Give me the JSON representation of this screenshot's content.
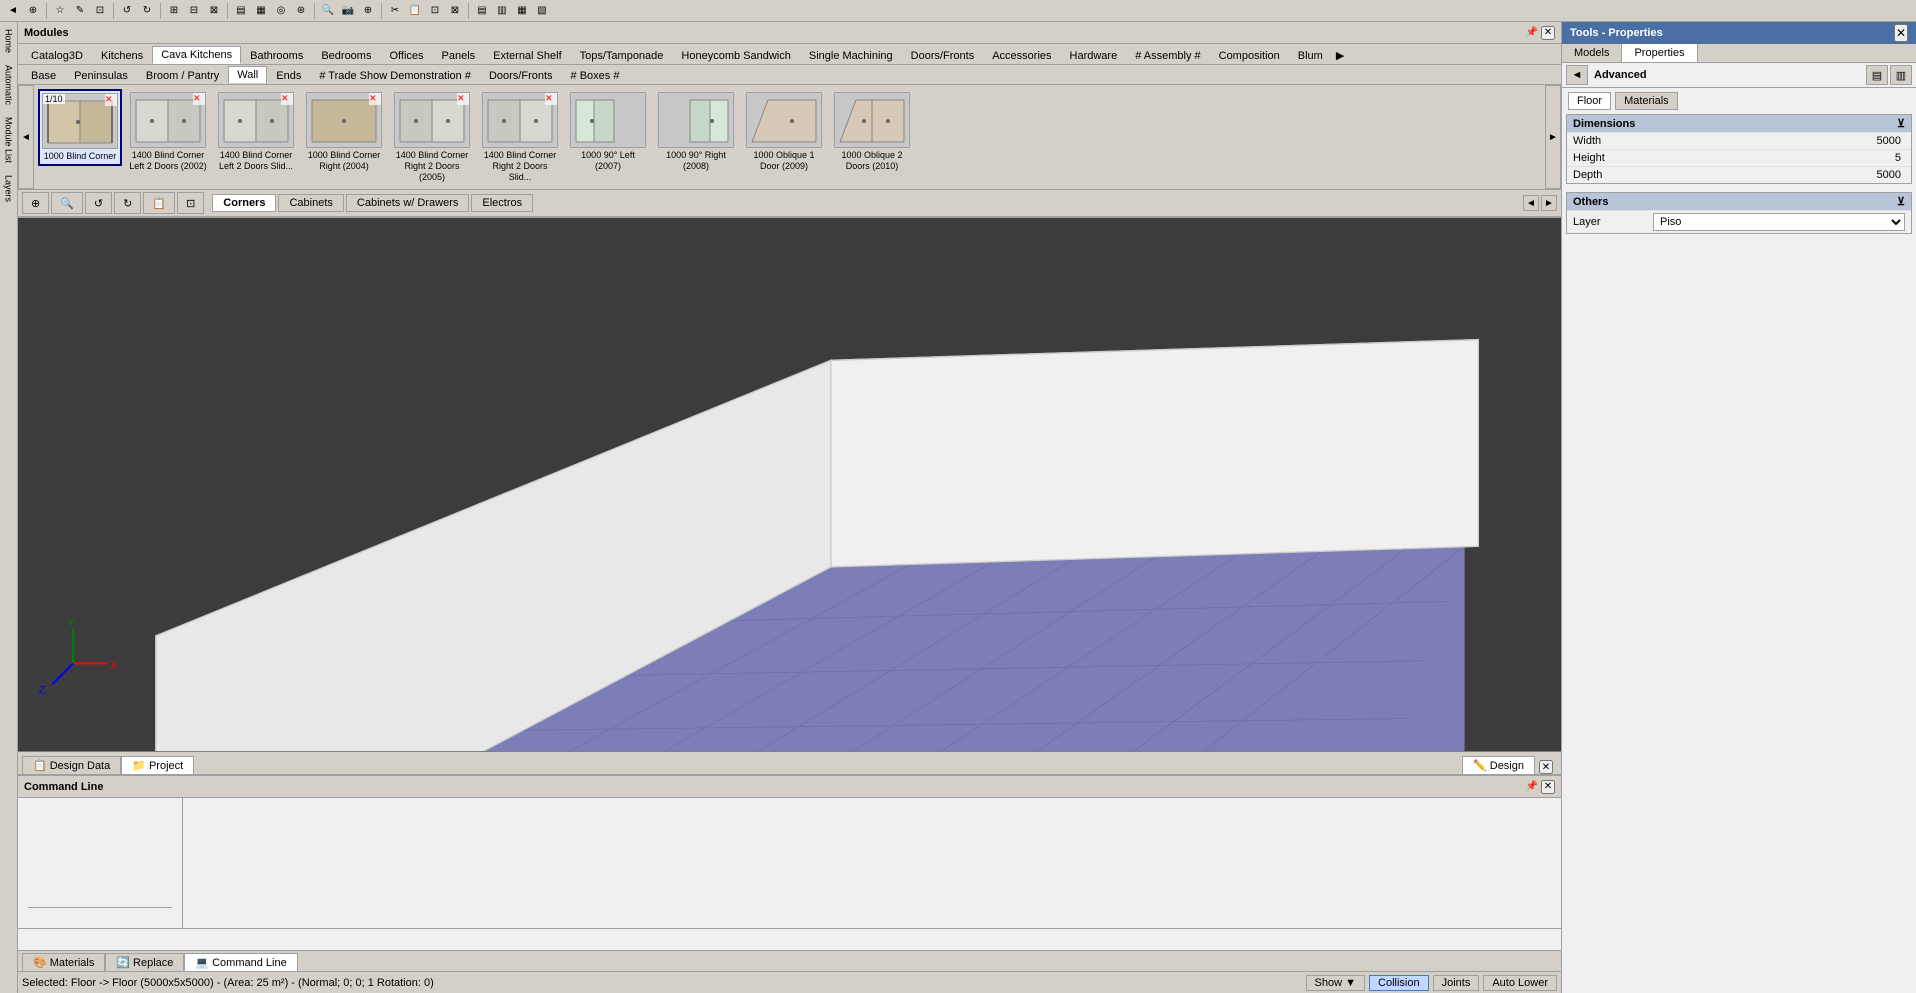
{
  "app": {
    "title": "Modules",
    "rightPanel": {
      "title": "Tools - Properties"
    }
  },
  "toolbar": {
    "buttons": [
      "◄",
      "▶",
      "⊕",
      "⊙",
      "⊡",
      "↺",
      "↻",
      "✎",
      "⊞",
      "⊟",
      "⊠",
      "⊛",
      "⊜",
      "▤",
      "▥",
      "▦",
      "▧",
      "▨"
    ],
    "separator_positions": [
      2,
      5,
      8,
      12,
      16
    ]
  },
  "categoryTabs": [
    {
      "label": "Catalog3D",
      "active": false
    },
    {
      "label": "Kitchens",
      "active": false
    },
    {
      "label": "Cava Kitchens",
      "active": false
    },
    {
      "label": "Bathrooms",
      "active": false
    },
    {
      "label": "Bedrooms",
      "active": false
    },
    {
      "label": "Offices",
      "active": false
    },
    {
      "label": "Panels",
      "active": false
    },
    {
      "label": "External Shelf",
      "active": false
    },
    {
      "label": "Tops/Tamponade",
      "active": false
    },
    {
      "label": "Honeycomb Sandwich",
      "active": false
    },
    {
      "label": "Single Machining",
      "active": false
    },
    {
      "label": "Doors/Fronts",
      "active": false
    },
    {
      "label": "Accessories",
      "active": false
    },
    {
      "label": "Hardware",
      "active": false
    },
    {
      "label": "# Assembly #",
      "active": false
    },
    {
      "label": "Composition",
      "active": false
    },
    {
      "label": "Blum",
      "active": false
    }
  ],
  "subCategoryTabs": [
    {
      "label": "Base",
      "active": false
    },
    {
      "label": "Peninsulas",
      "active": false
    },
    {
      "label": "Broom / Pantry",
      "active": false
    },
    {
      "label": "Wall",
      "active": true
    },
    {
      "label": "Ends",
      "active": false
    },
    {
      "label": "# Trade Show Demonstration #",
      "active": false
    },
    {
      "label": "Doors/Fronts",
      "active": false
    },
    {
      "label": "# Boxes #",
      "active": false
    }
  ],
  "moduleItems": [
    {
      "id": 1,
      "label": "1000 Blind Corner",
      "counter": "1/10",
      "selected": true,
      "hasDelete": true
    },
    {
      "id": 2,
      "label": "1400 Blind Corner Left 2 Doors (2002)",
      "counter": "",
      "selected": false,
      "hasDelete": true
    },
    {
      "id": 3,
      "label": "1400 Blind Corner Left 2 Doors Slid...",
      "counter": "",
      "selected": false,
      "hasDelete": true
    },
    {
      "id": 4,
      "label": "1000 Blind Corner Right (2004)",
      "counter": "",
      "selected": false,
      "hasDelete": true
    },
    {
      "id": 5,
      "label": "1400 Blind Corner Right 2 Doors (2005)",
      "counter": "",
      "selected": false,
      "hasDelete": true
    },
    {
      "id": 6,
      "label": "1400 Blind Corner Right 2 Doors Slid...",
      "counter": "",
      "selected": false,
      "hasDelete": true
    },
    {
      "id": 7,
      "label": "1000 90° Left (2007)",
      "counter": "",
      "selected": false,
      "hasDelete": false
    },
    {
      "id": 8,
      "label": "1000 90° Right (2008)",
      "counter": "",
      "selected": false,
      "hasDelete": false
    },
    {
      "id": 9,
      "label": "1000 Oblique 1 Door (2009)",
      "counter": "",
      "selected": false,
      "hasDelete": false
    },
    {
      "id": 10,
      "label": "1000 Oblique 2 Doors (2010)",
      "counter": "",
      "selected": false,
      "hasDelete": false
    }
  ],
  "filterTabs": [
    {
      "label": "Corners",
      "active": true
    },
    {
      "label": "Cabinets",
      "active": false
    },
    {
      "label": "Cabinets w/ Drawers",
      "active": false
    },
    {
      "label": "Electros",
      "active": false
    }
  ],
  "bottomTabs": [
    {
      "label": "Design Data",
      "icon": "📋",
      "active": false
    },
    {
      "label": "Project",
      "icon": "📁",
      "active": true
    }
  ],
  "bottomPanelTabs": [
    {
      "label": "Design",
      "icon": "✏️",
      "active": true
    }
  ],
  "commandPanel": {
    "title": "Command Line"
  },
  "commandTabs": [
    {
      "label": "Materials",
      "active": false
    },
    {
      "label": "Replace",
      "active": false
    },
    {
      "label": "Command Line",
      "active": true
    }
  ],
  "statusBar": {
    "text": "Selected: Floor -> Floor (5000x5x5000) - (Area: 25 m²) - (Normal; 0; 0; 1 Rotation: 0)",
    "showBtn": "Show ▼",
    "collisionBtn": "Collision",
    "jointsBtn": "Joints",
    "autoLowerBtn": "Auto Lower"
  },
  "rightPanel": {
    "viewTabs": [
      {
        "label": "Models",
        "active": false
      },
      {
        "label": "Properties",
        "active": true
      }
    ],
    "advancedTab": "Advanced",
    "tableIcon1": "▤",
    "tableIcon2": "▥",
    "subTabs": [
      {
        "label": "Floor",
        "active": true
      },
      {
        "label": "Materials",
        "active": false
      }
    ],
    "sections": {
      "dimensions": {
        "title": "Dimensions",
        "properties": [
          {
            "label": "Width",
            "value": "5000"
          },
          {
            "label": "Height",
            "value": "5"
          },
          {
            "label": "Depth",
            "value": "5000"
          }
        ]
      },
      "others": {
        "title": "Others",
        "properties": [
          {
            "label": "Layer",
            "value": "Piso"
          }
        ]
      }
    }
  },
  "leftSidebar": {
    "tabs": [
      "Home",
      "Automatic",
      "Module List",
      "Layers"
    ]
  }
}
